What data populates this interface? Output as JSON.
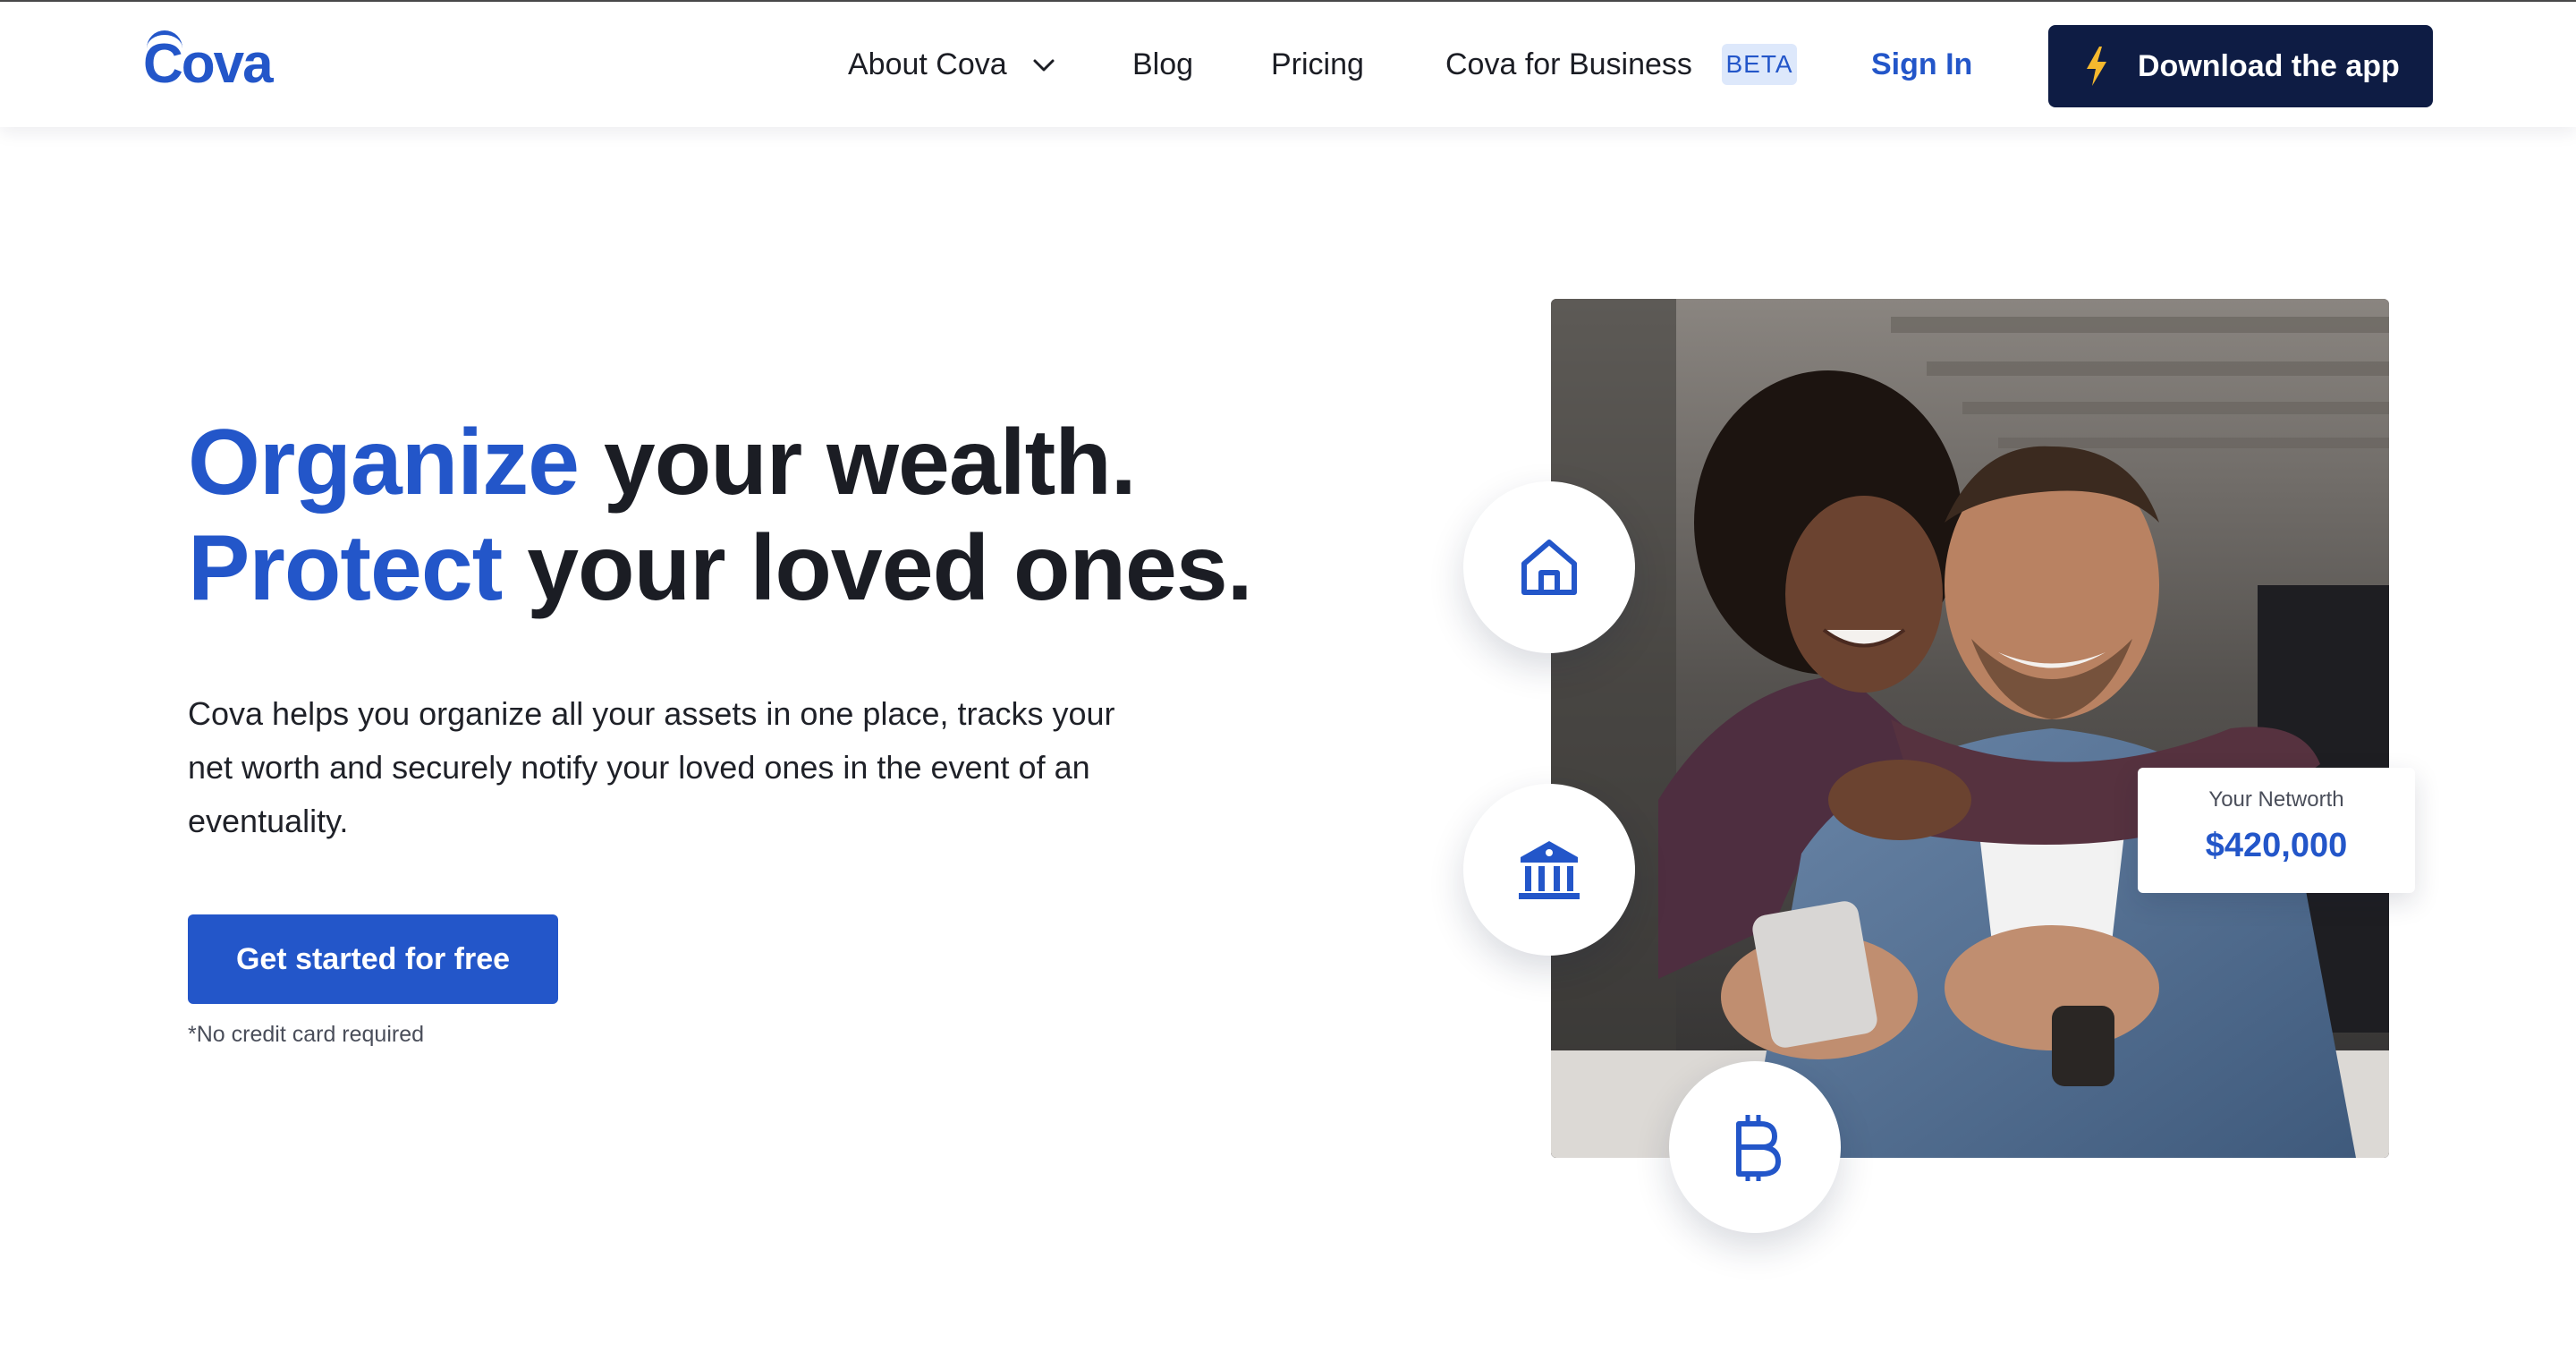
{
  "header": {
    "logo_text": "Cova",
    "nav": {
      "about": "About Cova",
      "blog": "Blog",
      "pricing": "Pricing",
      "business": "Cova for Business",
      "beta_badge": "BETA"
    },
    "sign_in": "Sign In",
    "download": "Download the app"
  },
  "hero": {
    "headline": {
      "line1_accent": "Organize",
      "line1_rest": " your wealth.",
      "line2_accent": "Protect",
      "line2_rest": " your loved ones."
    },
    "description": "Cova helps you organize all your assets in one place, tracks your net worth and securely notify your loved ones in the event of an eventuality.",
    "cta": "Get started for free",
    "footnote": "*No credit card required"
  },
  "networth_card": {
    "label": "Your Networth",
    "value": "$420,000"
  },
  "icons": {
    "home": "home-icon",
    "bank": "bank-icon",
    "bitcoin": "bitcoin-icon",
    "chevron": "chevron-down-icon",
    "bolt": "lightning-bolt-icon"
  },
  "colors": {
    "brand_blue": "#2356c9",
    "dark_navy": "#0e1c44",
    "beta_bg": "#dde8fb",
    "bolt": "#f5b82e",
    "text": "#1b1d24"
  }
}
